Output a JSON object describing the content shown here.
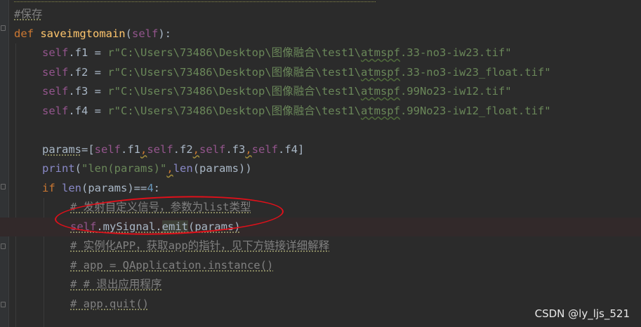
{
  "editor": {
    "lines": [
      {
        "indent": 0,
        "tokens": [
          {
            "t": "#保存",
            "c": "cmt",
            "u": "dotted"
          }
        ]
      },
      {
        "indent": 0,
        "tokens": [
          {
            "t": "def ",
            "c": "kw"
          },
          {
            "t": "saveimgtomain",
            "c": "fn"
          },
          {
            "t": "(",
            "c": "plain"
          },
          {
            "t": "self",
            "c": "slf"
          },
          {
            "t": "):",
            "c": "plain"
          }
        ]
      },
      {
        "indent": 1,
        "tokens": [
          {
            "t": "self",
            "c": "slf"
          },
          {
            "t": ".f1 = ",
            "c": "plain"
          },
          {
            "t": "r\"C:\\Users\\73486\\Desktop\\图像融合\\test1\\",
            "c": "str"
          },
          {
            "t": "atmspf",
            "c": "str",
            "u": "green"
          },
          {
            "t": ".33-no3-iw23.tif\"",
            "c": "str"
          }
        ]
      },
      {
        "indent": 1,
        "tokens": [
          {
            "t": "self",
            "c": "slf"
          },
          {
            "t": ".f2 = ",
            "c": "plain"
          },
          {
            "t": "r\"C:\\Users\\73486\\Desktop\\图像融合\\test1\\",
            "c": "str"
          },
          {
            "t": "atmspf",
            "c": "str",
            "u": "green"
          },
          {
            "t": ".33-no3-iw23_float.tif\"",
            "c": "str"
          }
        ]
      },
      {
        "indent": 1,
        "tokens": [
          {
            "t": "self",
            "c": "slf"
          },
          {
            "t": ".f3 = ",
            "c": "plain"
          },
          {
            "t": "r\"C:\\Users\\73486\\Desktop\\图像融合\\test1\\",
            "c": "str"
          },
          {
            "t": "atmspf",
            "c": "str",
            "u": "green"
          },
          {
            "t": ".99No23-iw12.tif\"",
            "c": "str"
          }
        ]
      },
      {
        "indent": 1,
        "tokens": [
          {
            "t": "self",
            "c": "slf"
          },
          {
            "t": ".f4 = ",
            "c": "plain"
          },
          {
            "t": "r\"C:\\Users\\73486\\Desktop\\图像融合\\test1\\",
            "c": "str"
          },
          {
            "t": "atmspf",
            "c": "str",
            "u": "green"
          },
          {
            "t": ".99No23-iw12_float.tif\"",
            "c": "str"
          }
        ]
      },
      {
        "indent": 1,
        "tokens": []
      },
      {
        "indent": 1,
        "tokens": [
          {
            "t": "params",
            "c": "plain",
            "u": "dotted"
          },
          {
            "t": "=[",
            "c": "plain"
          },
          {
            "t": "self",
            "c": "slf"
          },
          {
            "t": ".f1",
            "c": "plain"
          },
          {
            "t": ",",
            "c": "kw",
            "u": "comma"
          },
          {
            "t": "self",
            "c": "slf"
          },
          {
            "t": ".f2",
            "c": "plain"
          },
          {
            "t": ",",
            "c": "kw",
            "u": "comma"
          },
          {
            "t": "self",
            "c": "slf"
          },
          {
            "t": ".f3",
            "c": "plain"
          },
          {
            "t": ",",
            "c": "kw",
            "u": "comma"
          },
          {
            "t": "self",
            "c": "slf"
          },
          {
            "t": ".f4]",
            "c": "plain"
          }
        ]
      },
      {
        "indent": 1,
        "tokens": [
          {
            "t": "print",
            "c": "builtin"
          },
          {
            "t": "(",
            "c": "plain"
          },
          {
            "t": "\"len(params)\"",
            "c": "str"
          },
          {
            "t": ",",
            "c": "kw",
            "u": "comma"
          },
          {
            "t": "len",
            "c": "builtin"
          },
          {
            "t": "(params))",
            "c": "plain"
          }
        ]
      },
      {
        "indent": 1,
        "tokens": [
          {
            "t": "if ",
            "c": "kw"
          },
          {
            "t": "len",
            "c": "builtin"
          },
          {
            "t": "(params)==",
            "c": "plain"
          },
          {
            "t": "4",
            "c": "num"
          },
          {
            "t": ":",
            "c": "plain"
          }
        ]
      },
      {
        "indent": 2,
        "tokens": [
          {
            "t": "# 发射自定义信号，参数为list类型",
            "c": "cmt",
            "u": "dotted"
          }
        ]
      },
      {
        "indent": 2,
        "highlight": true,
        "tokens": [
          {
            "t": "self",
            "c": "slf",
            "u": "dotted"
          },
          {
            "t": ".mySignal.",
            "c": "plain",
            "u": "dotted"
          },
          {
            "t": "emit",
            "c": "plain",
            "u": "dotted",
            "bg": "emit"
          },
          {
            "t": "(params)",
            "c": "plain",
            "u": "dotted"
          }
        ]
      },
      {
        "indent": 2,
        "tokens": [
          {
            "t": "# 实例化APP，获取app的指针，见下方链接详细解释",
            "c": "cmt",
            "u": "dotted"
          }
        ]
      },
      {
        "indent": 2,
        "tokens": [
          {
            "t": "# app = QApplication.instance()",
            "c": "cmt",
            "u": "dotted"
          }
        ]
      },
      {
        "indent": 2,
        "tokens": [
          {
            "t": "# # 退出应用程序",
            "c": "cmt",
            "u": "dotted"
          }
        ]
      },
      {
        "indent": 2,
        "tokens": [
          {
            "t": "# app.quit()",
            "c": "cmt",
            "u": "dotted"
          }
        ]
      }
    ]
  },
  "watermark": {
    "text": "CSDN @ly_ljs_521"
  },
  "colors": {
    "background": "#2b2b2b",
    "keyword": "#cc7832",
    "function": "#ffc66d",
    "self": "#94558d",
    "string": "#6a8759",
    "number": "#6897bb",
    "builtin": "#8888c6",
    "comment": "#808080",
    "annotation": "#e0101a"
  }
}
